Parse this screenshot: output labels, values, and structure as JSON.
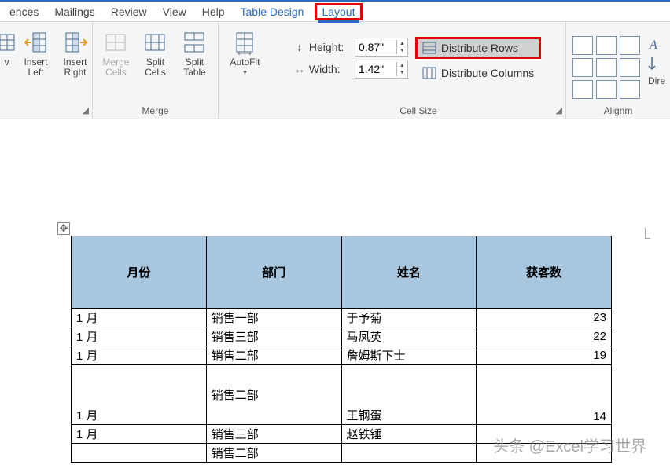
{
  "menubar": {
    "items": [
      "ences",
      "Mailings",
      "Review",
      "View",
      "Help"
    ],
    "contextual": [
      "Table Design",
      "Layout"
    ],
    "active": "Layout"
  },
  "ribbon": {
    "rows_cols": {
      "partial_btn": "v",
      "insert_left": "Insert\nLeft",
      "insert_right": "Insert\nRight",
      "label_suffix": ""
    },
    "merge": {
      "merge_cells": "Merge\nCells",
      "split_cells": "Split\nCells",
      "split_table": "Split\nTable",
      "label": "Merge"
    },
    "autofit": {
      "label": "AutoFit"
    },
    "cell_size": {
      "height_label": "Height:",
      "height_value": "0.87\"",
      "width_label": "Width:",
      "width_value": "1.42\"",
      "dist_rows": "Distribute Rows",
      "dist_cols": "Distribute Columns",
      "label": "Cell Size"
    },
    "alignment": {
      "dir_label": "Dire",
      "label": "Alignm"
    }
  },
  "table": {
    "headers": [
      "月份",
      "部门",
      "姓名",
      "获客数"
    ],
    "rows": [
      {
        "month": "1 月",
        "dept": "销售一部",
        "name": "于予菊",
        "count": "23"
      },
      {
        "month": "1 月",
        "dept": "销售三部",
        "name": "马凤英",
        "count": "22"
      },
      {
        "month": "1 月",
        "dept": "销售二部",
        "name": "詹姆斯下士",
        "count": "19"
      },
      {
        "month": "1 月",
        "dept": "销售二部",
        "name": "王钢蛋",
        "count": "14",
        "tall": true
      },
      {
        "month": "1 月",
        "dept": "销售三部",
        "name": "赵铁锤",
        "count": ""
      },
      {
        "month": "",
        "dept": "销售二部",
        "name": "",
        "count": ""
      }
    ]
  },
  "watermark": "头条 @Excel学习世界"
}
